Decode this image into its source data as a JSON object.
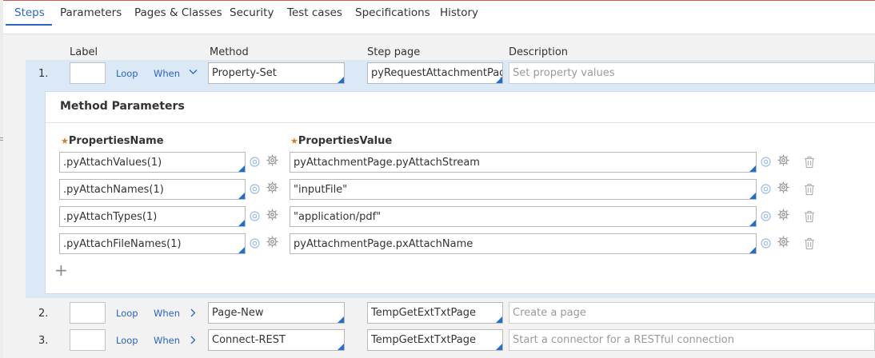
{
  "tabs": [
    "Steps",
    "Parameters",
    "Pages & Classes",
    "Security",
    "Test cases",
    "Specifications",
    "History"
  ],
  "active_tab": "Steps",
  "columns": {
    "label": "Label",
    "method": "Method",
    "step_page": "Step page",
    "description": "Description"
  },
  "steps": [
    {
      "num": "1.",
      "loop": "Loop",
      "when": "When",
      "method": "Property-Set",
      "step_page": "pyRequestAttachmentPage",
      "description": "Set property values",
      "expanded": true
    },
    {
      "num": "2.",
      "loop": "Loop",
      "when": "When",
      "method": "Page-New",
      "step_page": "TempGetExtTxtPage",
      "description": "Create a page",
      "expanded": false
    },
    {
      "num": "3.",
      "loop": "Loop",
      "when": "When",
      "method": "Connect-REST",
      "step_page": "TempGetExtTxtPage",
      "description": "Start a connector for a RESTful connection",
      "expanded": false
    }
  ],
  "method_params": {
    "title": "Method Parameters",
    "name_header": "PropertiesName",
    "value_header": "PropertiesValue",
    "rows": [
      {
        "name": ".pyAttachValues(1)",
        "value": "pyAttachmentPage.pyAttachStream"
      },
      {
        "name": ".pyAttachNames(1)",
        "value": "\"inputFile\""
      },
      {
        "name": ".pyAttachTypes(1)",
        "value": "\"application/pdf\""
      },
      {
        "name": ".pyAttachFileNames(1)",
        "value": "pyAttachmentPage.pxAttachName"
      }
    ]
  },
  "colors": {
    "accent": "#2a64c5",
    "highlight": "#dbe9f6",
    "required_star": "#e07a1f",
    "corner": "#1d6fd6"
  },
  "icons": {
    "target": "target-icon",
    "gear": "gear-icon",
    "trash": "trash-icon",
    "add": "plus-icon",
    "expand": "chevron-down-icon",
    "collapse": "chevron-right-icon"
  }
}
